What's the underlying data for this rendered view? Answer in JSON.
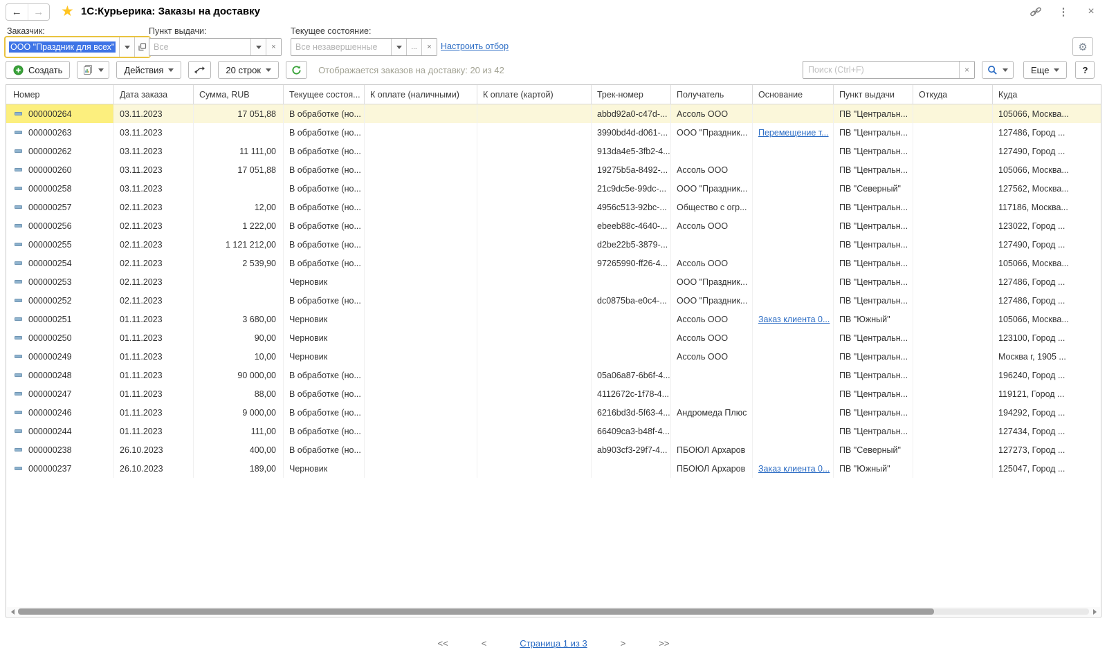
{
  "window": {
    "title": "1С:Курьерика: Заказы на доставку"
  },
  "filters": {
    "customer": {
      "label": "Заказчик:",
      "value": "ООО \"Праздник для всех\""
    },
    "pickup_point": {
      "label": "Пункт выдачи:",
      "placeholder": "Все"
    },
    "current_state": {
      "label": "Текущее состояние:",
      "placeholder": "Все незавершенные",
      "ellipsis_button": "..."
    },
    "configure_filter_link": "Настроить отбор"
  },
  "toolbar": {
    "create_label": "Создать",
    "actions_label": "Действия",
    "rows_label": "20 строк",
    "status_text": "Отображается заказов на доставку: 20 из 42",
    "search_placeholder": "Поиск (Ctrl+F)",
    "more_label": "Еще",
    "help_label": "?"
  },
  "table": {
    "columns": [
      "Номер",
      "Дата заказа",
      "Сумма, RUB",
      "Текущее состоя...",
      "К оплате (наличными)",
      "К оплате (картой)",
      "Трек-номер",
      "Получатель",
      "Основание",
      "Пункт выдачи",
      "Откуда",
      "Куда"
    ],
    "rows": [
      {
        "number": "000000264",
        "date": "03.11.2023",
        "sum": "17 051,88",
        "state": "В обработке (но...",
        "cash": "",
        "card": "",
        "track": "abbd92a0-c47d-...",
        "recipient": "Ассоль ООО",
        "basis": "",
        "basis_link": false,
        "pickup": "ПВ \"Центральн...",
        "from": "",
        "to": "105066, Москва...",
        "selected": true
      },
      {
        "number": "000000263",
        "date": "03.11.2023",
        "sum": "",
        "state": "В обработке (но...",
        "cash": "",
        "card": "",
        "track": "3990bd4d-d061-...",
        "recipient": "ООО \"Праздник...",
        "basis": "Перемещение т...",
        "basis_link": true,
        "pickup": "ПВ \"Центральн...",
        "from": "",
        "to": "127486, Город ...",
        "selected": false
      },
      {
        "number": "000000262",
        "date": "03.11.2023",
        "sum": "11 111,00",
        "state": "В обработке (но...",
        "cash": "",
        "card": "",
        "track": "913da4e5-3fb2-4...",
        "recipient": "",
        "basis": "",
        "basis_link": false,
        "pickup": "ПВ \"Центральн...",
        "from": "",
        "to": "127490, Город ...",
        "selected": false
      },
      {
        "number": "000000260",
        "date": "03.11.2023",
        "sum": "17 051,88",
        "state": "В обработке (но...",
        "cash": "",
        "card": "",
        "track": "19275b5a-8492-...",
        "recipient": "Ассоль ООО",
        "basis": "",
        "basis_link": false,
        "pickup": "ПВ \"Центральн...",
        "from": "",
        "to": "105066, Москва...",
        "selected": false
      },
      {
        "number": "000000258",
        "date": "03.11.2023",
        "sum": "",
        "state": "В обработке (но...",
        "cash": "",
        "card": "",
        "track": "21c9dc5e-99dc-...",
        "recipient": "ООО \"Праздник...",
        "basis": "",
        "basis_link": false,
        "pickup": "ПВ \"Северный\"",
        "from": "",
        "to": "127562, Москва...",
        "selected": false
      },
      {
        "number": "000000257",
        "date": "02.11.2023",
        "sum": "12,00",
        "state": "В обработке (но...",
        "cash": "",
        "card": "",
        "track": "4956c513-92bc-...",
        "recipient": "Общество с огр...",
        "basis": "",
        "basis_link": false,
        "pickup": "ПВ \"Центральн...",
        "from": "",
        "to": "117186, Москва...",
        "selected": false
      },
      {
        "number": "000000256",
        "date": "02.11.2023",
        "sum": "1 222,00",
        "state": "В обработке (но...",
        "cash": "",
        "card": "",
        "track": "ebeeb88c-4640-...",
        "recipient": "Ассоль ООО",
        "basis": "",
        "basis_link": false,
        "pickup": "ПВ \"Центральн...",
        "from": "",
        "to": "123022, Город ...",
        "selected": false
      },
      {
        "number": "000000255",
        "date": "02.11.2023",
        "sum": "1 121 212,00",
        "state": "В обработке (но...",
        "cash": "",
        "card": "",
        "track": "d2be22b5-3879-...",
        "recipient": "",
        "basis": "",
        "basis_link": false,
        "pickup": "ПВ \"Центральн...",
        "from": "",
        "to": "127490, Город ...",
        "selected": false
      },
      {
        "number": "000000254",
        "date": "02.11.2023",
        "sum": "2 539,90",
        "state": "В обработке (но...",
        "cash": "",
        "card": "",
        "track": "97265990-ff26-4...",
        "recipient": "Ассоль ООО",
        "basis": "",
        "basis_link": false,
        "pickup": "ПВ \"Центральн...",
        "from": "",
        "to": "105066, Москва...",
        "selected": false
      },
      {
        "number": "000000253",
        "date": "02.11.2023",
        "sum": "",
        "state": "Черновик",
        "cash": "",
        "card": "",
        "track": "",
        "recipient": "ООО \"Праздник...",
        "basis": "",
        "basis_link": false,
        "pickup": "ПВ \"Центральн...",
        "from": "",
        "to": "127486, Город ...",
        "selected": false
      },
      {
        "number": "000000252",
        "date": "02.11.2023",
        "sum": "",
        "state": "В обработке (но...",
        "cash": "",
        "card": "",
        "track": "dc0875ba-e0c4-...",
        "recipient": "ООО \"Праздник...",
        "basis": "",
        "basis_link": false,
        "pickup": "ПВ \"Центральн...",
        "from": "",
        "to": "127486, Город ...",
        "selected": false
      },
      {
        "number": "000000251",
        "date": "01.11.2023",
        "sum": "3 680,00",
        "state": "Черновик",
        "cash": "",
        "card": "",
        "track": "",
        "recipient": "Ассоль ООО",
        "basis": "Заказ клиента 0...",
        "basis_link": true,
        "pickup": "ПВ \"Южный\"",
        "from": "",
        "to": "105066, Москва...",
        "selected": false
      },
      {
        "number": "000000250",
        "date": "01.11.2023",
        "sum": "90,00",
        "state": "Черновик",
        "cash": "",
        "card": "",
        "track": "",
        "recipient": "Ассоль ООО",
        "basis": "",
        "basis_link": false,
        "pickup": "ПВ \"Центральн...",
        "from": "",
        "to": "123100, Город ...",
        "selected": false
      },
      {
        "number": "000000249",
        "date": "01.11.2023",
        "sum": "10,00",
        "state": "Черновик",
        "cash": "",
        "card": "",
        "track": "",
        "recipient": "Ассоль ООО",
        "basis": "",
        "basis_link": false,
        "pickup": "ПВ \"Центральн...",
        "from": "",
        "to": "Москва г, 1905 ...",
        "selected": false
      },
      {
        "number": "000000248",
        "date": "01.11.2023",
        "sum": "90 000,00",
        "state": "В обработке (но...",
        "cash": "",
        "card": "",
        "track": "05a06a87-6b6f-4...",
        "recipient": "",
        "basis": "",
        "basis_link": false,
        "pickup": "ПВ \"Центральн...",
        "from": "",
        "to": "196240, Город ...",
        "selected": false
      },
      {
        "number": "000000247",
        "date": "01.11.2023",
        "sum": "88,00",
        "state": "В обработке (но...",
        "cash": "",
        "card": "",
        "track": "4112672c-1f78-4...",
        "recipient": "",
        "basis": "",
        "basis_link": false,
        "pickup": "ПВ \"Центральн...",
        "from": "",
        "to": "119121, Город ...",
        "selected": false
      },
      {
        "number": "000000246",
        "date": "01.11.2023",
        "sum": "9 000,00",
        "state": "В обработке (но...",
        "cash": "",
        "card": "",
        "track": "6216bd3d-5f63-4...",
        "recipient": "Андромеда Плюс",
        "basis": "",
        "basis_link": false,
        "pickup": "ПВ \"Центральн...",
        "from": "",
        "to": "194292, Город ...",
        "selected": false
      },
      {
        "number": "000000244",
        "date": "01.11.2023",
        "sum": "111,00",
        "state": "В обработке (но...",
        "cash": "",
        "card": "",
        "track": "66409ca3-b48f-4...",
        "recipient": "",
        "basis": "",
        "basis_link": false,
        "pickup": "ПВ \"Центральн...",
        "from": "",
        "to": "127434, Город ...",
        "selected": false
      },
      {
        "number": "000000238",
        "date": "26.10.2023",
        "sum": "400,00",
        "state": "В обработке (но...",
        "cash": "",
        "card": "",
        "track": "ab903cf3-29f7-4...",
        "recipient": "ПБОЮЛ Архаров",
        "basis": "",
        "basis_link": false,
        "pickup": "ПВ \"Северный\"",
        "from": "",
        "to": "127273, Город ...",
        "selected": false
      },
      {
        "number": "000000237",
        "date": "26.10.2023",
        "sum": "189,00",
        "state": "Черновик",
        "cash": "",
        "card": "",
        "track": "",
        "recipient": "ПБОЮЛ Архаров",
        "basis": "Заказ клиента 0...",
        "basis_link": true,
        "pickup": "ПВ \"Южный\"",
        "from": "",
        "to": "125047, Город ...",
        "selected": false
      }
    ]
  },
  "pagination": {
    "first": "<<",
    "prev": "<",
    "page_label": "Страница 1 из 3",
    "next": ">",
    "last": ">>"
  },
  "colors": {
    "selection_blue": "#3e74e6",
    "active_field_border": "#e9c33f",
    "link_blue": "#2b6cc4",
    "row_selected_bg": "#fbf7da",
    "current_cell_bg": "#fcef7e",
    "accent_green": "#3aa33a",
    "favorite_star": "#ffc421"
  }
}
